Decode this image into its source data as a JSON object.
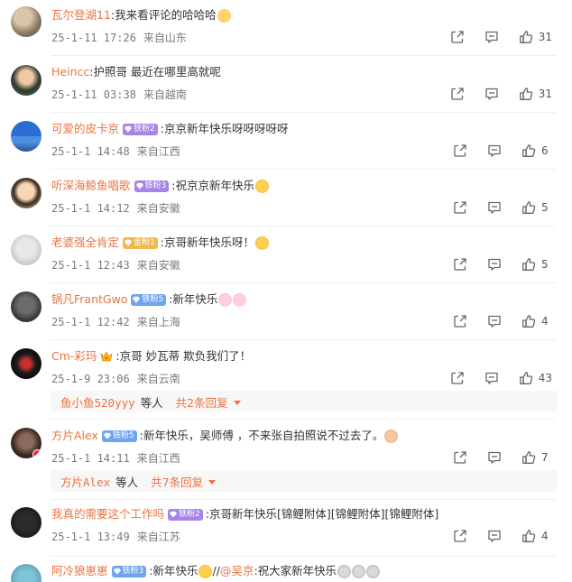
{
  "comments": [
    {
      "user": "瓦尔登湖11",
      "text": "我来看评论的哈哈哈",
      "time": "25-1-11 17:26",
      "location": "来自山东",
      "likes": "31"
    },
    {
      "user": "Heincc",
      "text": "护照哥 最近在哪里高就呢",
      "time": "25-1-11 03:38",
      "location": "来自越南",
      "likes": "31"
    },
    {
      "user": "可爱的皮卡京",
      "badge": "铁粉2",
      "text": "京京新年快乐呀呀呀呀呀",
      "time": "25-1-1 14:48",
      "location": "来自江西",
      "likes": "6"
    },
    {
      "user": "听深海鲸鱼唱歌",
      "badge": "铁粉3",
      "text": "祝京京新年快乐",
      "time": "25-1-1 14:12",
      "location": "来自安徽",
      "likes": "5"
    },
    {
      "user": "老婆强全肯定",
      "badge": "金粉1",
      "text": "京哥新年快乐呀！",
      "time": "25-1-1 12:43",
      "location": "来自安徽",
      "likes": "5"
    },
    {
      "user": "锅凡FrantGwo",
      "badge": "铁粉5",
      "text": "新年快乐",
      "time": "25-1-1 12:42",
      "location": "来自上海",
      "likes": "4"
    },
    {
      "user": "Cm-彩玛",
      "text": "京哥 妙瓦蒂 欺负我们了！",
      "time": "25-1-9 23:06",
      "location": "来自云南",
      "likes": "43",
      "reply": {
        "name": "鱼小鱼520yyy",
        "mid": "等人",
        "count": "共2条回复"
      }
    },
    {
      "user": "方片Alex",
      "badge": "铁粉5",
      "text": "新年快乐，吴师傅 ，不来张自拍照说不过去了。",
      "time": "25-1-1 14:11",
      "location": "来自江西",
      "likes": "7",
      "reply": {
        "name": "方片Alex",
        "mid": "等人",
        "count": "共7条回复"
      }
    },
    {
      "user": "我真的需要这个工作吗",
      "badge": "铁粉2",
      "text": "京哥新年快乐[锦鲤附体][锦鲤附体][锦鲤附体]",
      "time": "25-1-1 13:49",
      "location": "来自江苏",
      "likes": "4"
    },
    {
      "user": "阿冷狼崽崽",
      "badge": "铁粉3",
      "text": "新年快乐",
      "repost_sep": "//",
      "repost_user": "@吴京",
      "repost_text": "祝大家新年快乐"
    }
  ],
  "colors": {
    "username": "#eb7340",
    "meta": "#7a7a7a",
    "fan_purple": "#a883e8",
    "fan_blue": "#6fa5f0",
    "fan_gold": "#f3b84b"
  },
  "icons": {
    "share": "share-icon",
    "comment": "comment-icon",
    "like": "thumbs-up-icon"
  }
}
